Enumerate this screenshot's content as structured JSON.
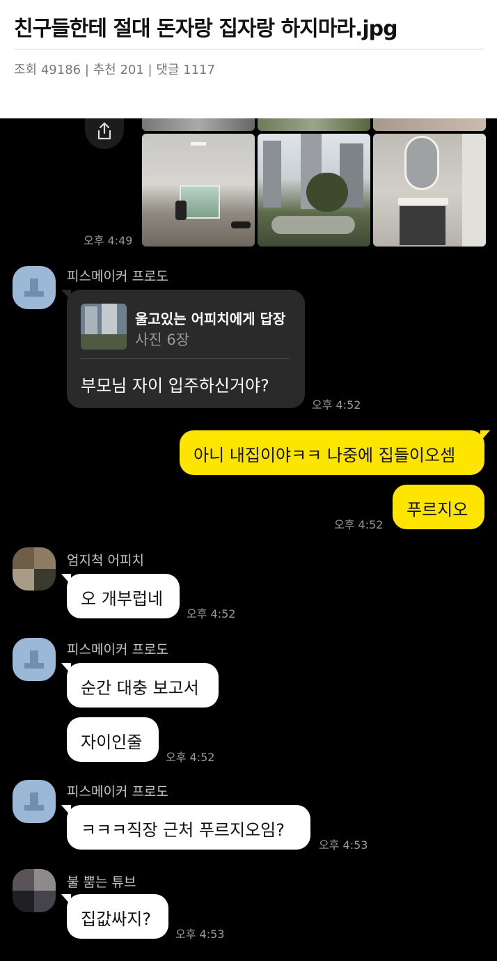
{
  "post": {
    "title": "친구들한테 절대 돈자랑 집자랑 하지마라.jpg",
    "meta": "조회 49186 | 추천 201 | 댓글 1117"
  },
  "chat": {
    "photo_time": "오후 4:49",
    "groups": [
      {
        "sender": "피스메이커 프로도",
        "reply_title": "울고있는 어피치에게 답장",
        "reply_sub": "사진 6장",
        "message": "부모님 자이 입주하신거야?",
        "time": "오후 4:52"
      },
      {
        "mine": [
          "아니 내집이야ㅋㅋ 나중에 집들이오셈",
          "푸르지오"
        ],
        "time": "오후 4:52"
      },
      {
        "sender": "엄지척 어피치",
        "messages": [
          "오 개부럽네"
        ],
        "time": "오후 4:52"
      },
      {
        "sender": "피스메이커 프로도",
        "messages": [
          "순간 대충 보고서",
          "자이인줄"
        ],
        "time": "오후 4:52"
      },
      {
        "sender": "피스메이커 프로도",
        "messages": [
          "ㅋㅋㅋ직장 근처 푸르지오임?"
        ],
        "time": "오후 4:53"
      },
      {
        "sender": "불 뿜는 튜브",
        "messages": [
          "집값싸지?"
        ],
        "time": "오후 4:53"
      }
    ]
  },
  "icons": {
    "share": "share-icon",
    "avatar_default": "default-person-icon"
  },
  "colors": {
    "chat_bg": "#000000",
    "my_bubble": "#fee500",
    "their_bubble": "#ffffff",
    "reply_bubble": "#2a2a2a",
    "avatar_default": "#9bb9d7"
  }
}
